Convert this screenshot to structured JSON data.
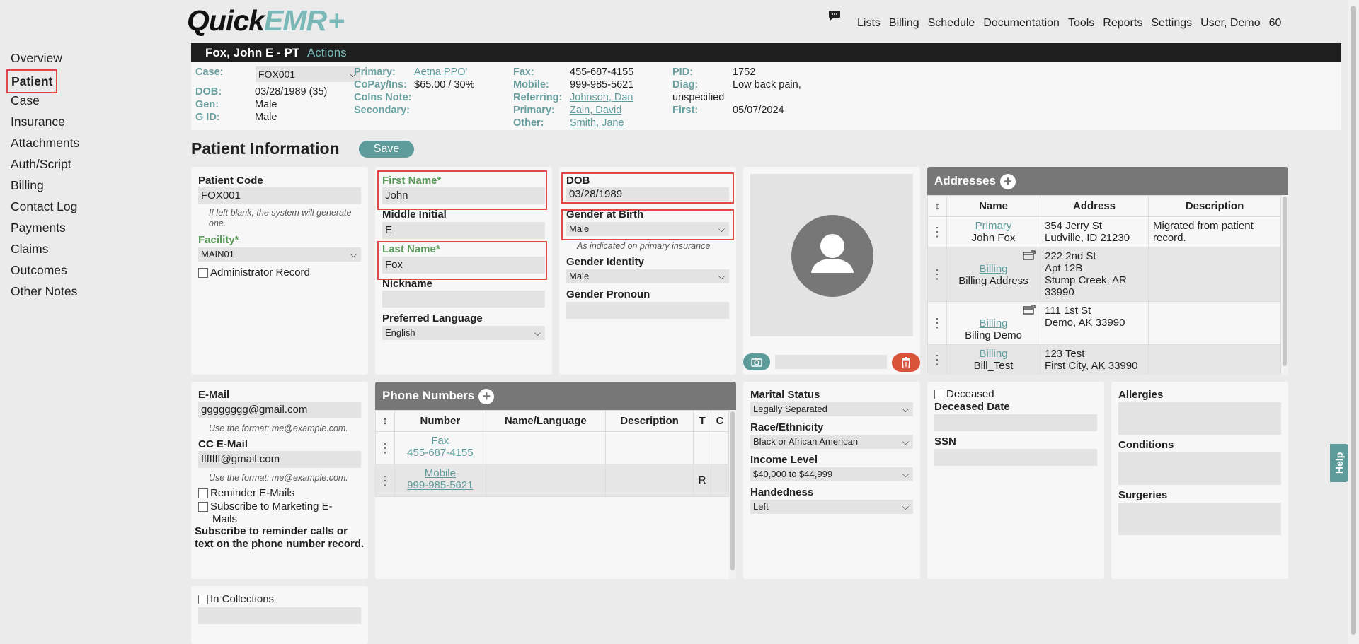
{
  "app": {
    "logo_quick": "Quick",
    "logo_emr": "EMR",
    "logo_plus": "+"
  },
  "topnav": [
    "Lists",
    "Billing",
    "Schedule",
    "Documentation",
    "Tools",
    "Reports",
    "Settings",
    "User, Demo",
    "60"
  ],
  "sidenav": [
    "Overview",
    "Patient",
    "Case",
    "Insurance",
    "Attachments",
    "Auth/Script",
    "Billing",
    "Contact Log",
    "Payments",
    "Claims",
    "Outcomes",
    "Other Notes"
  ],
  "patient_bar": {
    "name": "Fox, John E - PT",
    "actions": "Actions"
  },
  "summary": {
    "case_label": "Case:",
    "case_value": "FOX001",
    "dob_label": "DOB:",
    "dob_value": "03/28/1989 (35)",
    "gen_label": "Gen:",
    "gen_value": "Male",
    "gid_label": "G ID:",
    "gid_value": "Male",
    "primary_label": "Primary:",
    "primary_value": "Aetna PPO'",
    "copay_label": "CoPay/Ins:",
    "copay_value": "$65.00 / 30%",
    "coins_label": "CoIns Note:",
    "secondary_label": "Secondary:",
    "fax_label": "Fax:",
    "fax_value": "455-687-4155",
    "mobile_label": "Mobile:",
    "mobile_value": "999-985-5621",
    "referring_label": "Referring:",
    "referring_value": "Johnson, Dan",
    "primary2_label": "Primary:",
    "primary2_value": "Zain, David",
    "other_label": "Other:",
    "other_value": "Smith, Jane",
    "pid_label": "PID:",
    "pid_value": "1752",
    "diag_label": "Diag:",
    "diag_value": "Low back pain,",
    "diag_value2": "unspecified",
    "first_label": "First:",
    "first_value": "05/07/2024"
  },
  "page_title": "Patient Information",
  "save_label": "Save",
  "col1": {
    "patient_code_label": "Patient Code",
    "patient_code_value": "FOX001",
    "patient_code_hint": "If left blank, the system will generate one.",
    "facility_label": "Facility*",
    "facility_value": "MAIN01",
    "admin_record": "Administrator Record"
  },
  "col2": {
    "first_name_label": "First Name*",
    "first_name_value": "John",
    "middle_label": "Middle Initial",
    "middle_value": "E",
    "last_name_label": "Last Name*",
    "last_name_value": "Fox",
    "nickname_label": "Nickname",
    "nickname_value": "",
    "lang_label": "Preferred Language",
    "lang_value": "English"
  },
  "col3": {
    "dob_label": "DOB",
    "dob_value": "03/28/1989",
    "gab_label": "Gender at Birth",
    "gab_value": "Male",
    "gab_hint": "As indicated on primary insurance.",
    "gi_label": "Gender Identity",
    "gi_value": "Male",
    "gp_label": "Gender Pronoun",
    "gp_value": ""
  },
  "addresses": {
    "title": "Addresses",
    "headers": [
      "Name",
      "Address",
      "Description"
    ],
    "rows": [
      {
        "type": "Primary",
        "name": "John Fox",
        "addr": [
          "354 Jerry St",
          "Ludville, ID 21230"
        ],
        "desc": [
          "Migrated from patient",
          "record."
        ],
        "icon": false
      },
      {
        "type": "Billing",
        "name": "Billing Address",
        "addr": [
          "222 2nd St",
          "Apt 12B",
          "Stump Creek, AR",
          "33990"
        ],
        "desc": [],
        "icon": true
      },
      {
        "type": "Billing",
        "name": "Biling Demo",
        "addr": [
          "111 1st St",
          "Demo, AK 33990"
        ],
        "desc": [],
        "icon": true
      },
      {
        "type": "Billing",
        "name": "Bill_Test",
        "addr": [
          "123 Test",
          "First City, AK 33990"
        ],
        "desc": [],
        "icon": false
      }
    ]
  },
  "email": {
    "email_label": "E-Mail",
    "email_value": "gggggggg@gmail.com",
    "email_hint": "Use the format: me@example.com.",
    "cc_label": "CC E-Mail",
    "cc_value": "fffffff@gmail.com",
    "cc_hint": "Use the format: me@example.com.",
    "reminder": "Reminder E-Mails",
    "subscribe_marketing_1": "Subscribe to Marketing E-",
    "subscribe_marketing_2": "Mails",
    "subscribe_note": "Subscribe to reminder calls or text on the phone number record."
  },
  "phones": {
    "title": "Phone Numbers",
    "headers": [
      "Number",
      "Name/Language",
      "Description",
      "T",
      "C"
    ],
    "rows": [
      {
        "type": "Fax",
        "number": "455-687-4155",
        "t": ""
      },
      {
        "type": "Mobile",
        "number": "999-985-5621",
        "t": "R"
      }
    ]
  },
  "demo": {
    "marital_label": "Marital Status",
    "marital_value": "Legally Separated",
    "race_label": "Race/Ethnicity",
    "race_value": "Black or African American",
    "income_label": "Income Level",
    "income_value": "$40,000 to $44,999",
    "hand_label": "Handedness",
    "hand_value": "Left"
  },
  "deceased": {
    "deceased": "Deceased",
    "date_label": "Deceased Date",
    "ssn_label": "SSN"
  },
  "medical": {
    "allergies": "Allergies",
    "conditions": "Conditions",
    "surgeries": "Surgeries"
  },
  "collections": {
    "label": "In Collections"
  },
  "help": "Help"
}
